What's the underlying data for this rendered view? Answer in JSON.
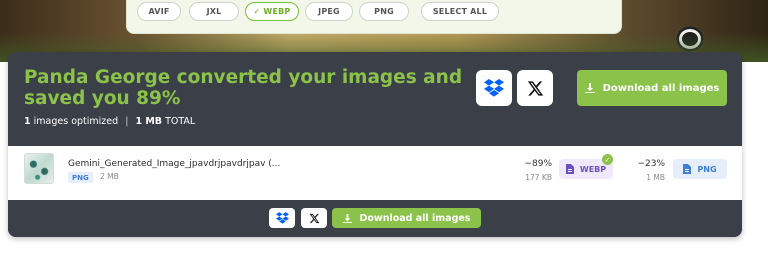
{
  "formats": {
    "avif": "AVIF",
    "jxl": "JXL",
    "webp": "WEBP",
    "jpeg": "JPEG",
    "png": "PNG",
    "select_all": "SELECT ALL",
    "selected": "WEBP"
  },
  "summary": {
    "headline": "Panda George converted your images and saved you 89%",
    "count_value": "1",
    "count_label": " images optimized",
    "size_value": "1 MB",
    "size_label": " TOTAL",
    "separator": "|"
  },
  "actions": {
    "download_all_label": "Download all images"
  },
  "file": {
    "name": "Gemini_Generated_Image_jpavdrjpavdrjpav (...",
    "type": "PNG",
    "size": "2 MB",
    "webp_saving": "−89%",
    "webp_size": "177 KB",
    "webp_label": "WEBP",
    "png_saving": "−23%",
    "png_size": "1 MB",
    "png_label": "PNG"
  },
  "footer": {
    "download_all_label": "Download all images"
  },
  "colors": {
    "accent_green": "#8bc34a",
    "panel_dark": "#3b3f48",
    "webp_purple": "#6d4fc2",
    "png_blue": "#3d7fd6"
  },
  "icons": [
    "dropbox-icon",
    "x-logo-icon",
    "download-icon",
    "check-icon",
    "file-icon"
  ]
}
